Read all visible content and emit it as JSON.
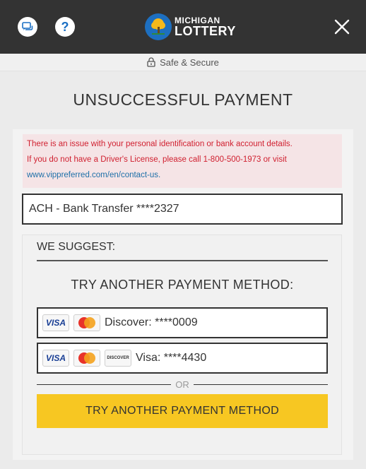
{
  "header": {
    "chat_icon": "chat-bubble-icon",
    "help_label": "?",
    "logo_line1": "MICHIGAN",
    "logo_line2": "LOTTERY",
    "close_icon": "close-x-icon"
  },
  "secure_bar": {
    "text": "Safe & Secure",
    "icon": "lock-icon"
  },
  "title": "UNSUCCESSFUL PAYMENT",
  "alert": {
    "line1": "There is an issue with your personal identification or bank account details.",
    "line2": "If you do not have a Driver's License, please call 1-800-500-1973 or visit",
    "link": "www.vippreferred.com/en/contact-us",
    "link_suffix": ".",
    "text_color": "#d01f2f",
    "bg_color": "#f5e4e6"
  },
  "failed_method": "ACH - Bank Transfer ****2327",
  "suggest": {
    "label": "WE SUGGEST:",
    "heading": "TRY ANOTHER PAYMENT METHOD:",
    "methods": [
      {
        "label": "Discover: ****0009",
        "cards": [
          "VISA",
          "MasterCard"
        ]
      },
      {
        "label": "Visa: ****4430",
        "cards": [
          "VISA",
          "MasterCard",
          "DISCOVER"
        ]
      }
    ],
    "or_text": "OR",
    "button_label": "TRY ANOTHER PAYMENT METHOD",
    "button_color": "#f7c722"
  }
}
